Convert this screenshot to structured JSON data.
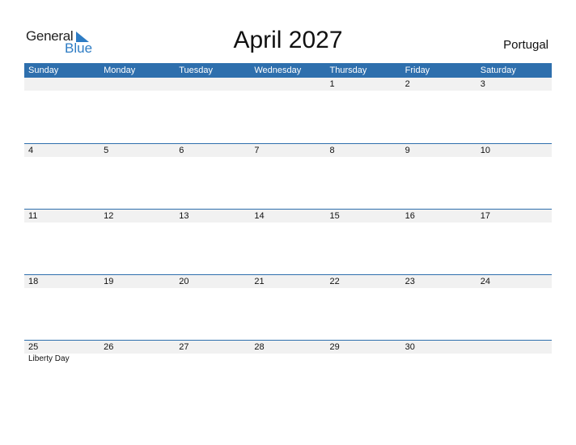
{
  "logo": {
    "general": "General",
    "blue": "Blue"
  },
  "title": "April 2027",
  "country": "Portugal",
  "weekdays": [
    "Sunday",
    "Monday",
    "Tuesday",
    "Wednesday",
    "Thursday",
    "Friday",
    "Saturday"
  ],
  "weeks": [
    [
      "",
      "",
      "",
      "",
      "1",
      "2",
      "3"
    ],
    [
      "4",
      "5",
      "6",
      "7",
      "8",
      "9",
      "10"
    ],
    [
      "11",
      "12",
      "13",
      "14",
      "15",
      "16",
      "17"
    ],
    [
      "18",
      "19",
      "20",
      "21",
      "22",
      "23",
      "24"
    ],
    [
      "25",
      "26",
      "27",
      "28",
      "29",
      "30",
      ""
    ]
  ],
  "holidays": [
    {
      "date": "25",
      "name": "Liberty Day"
    }
  ],
  "colors": {
    "accent": "#2e6fad",
    "band": "#f1f1f1",
    "logo_blue": "#2e7cc4"
  }
}
